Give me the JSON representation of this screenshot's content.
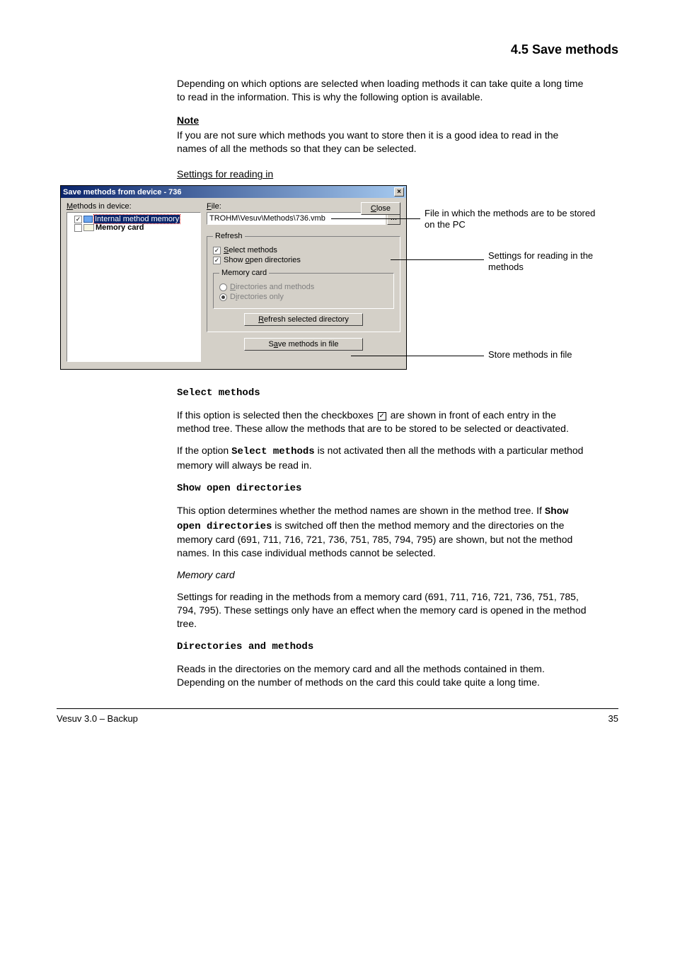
{
  "header": {
    "title": "4.5 Save methods"
  },
  "intro": {
    "p1": "Depending on which options are selected when loading methods it can take quite a long time to read in the information. This is why the following option is available.",
    "note_head": "Note",
    "note_text": "If you are not sure which methods you want to store then it is a good idea to read in the names of all the methods so that they can be selected.",
    "sub_head": "Settings for reading in"
  },
  "dialog": {
    "title": "Save methods from device - 736",
    "close_x": "×",
    "tree_label": "Methods in device:",
    "tree": {
      "internal": "Internal method memory",
      "card": "Memory card"
    },
    "file_label": "File:",
    "file_value": "TROHM\\Vesuv\\Methods\\736.vmb",
    "browse": "...",
    "close_btn": "Close",
    "refresh_group": "Refresh",
    "cb_select": "Select methods",
    "cb_showopen": "Show open directories",
    "mem_group": "Memory card",
    "rb_dirmeth": "Directories and methods",
    "rb_dironly": "Directories only",
    "btn_refresh": "Refresh selected directory",
    "btn_save": "Save methods in file"
  },
  "callouts": {
    "file": "File in which the methods are to be stored on the PC",
    "refresh": "Settings for reading in the methods",
    "save": "Store methods in file"
  },
  "body2": {
    "select_label": "Select methods",
    "select_p1_a": "If this option is selected then the checkboxes ",
    "select_p1_b": " are shown in front of each entry in the method tree. These allow the methods that are to be stored to be selected or deactivated.",
    "select_p2_a": "If the option ",
    "select_p2_b": " is not activated then all the methods with a particular method memory will always be read in.",
    "showopen_label": "Show open directories",
    "showopen_p_a": "This option determines whether the method names are shown in the method tree. If ",
    "showopen_p_b": " is switched off then the method memory and the directories on the memory card (691, 711, 716, 721, 736, 751, 785, 794, 795) are shown, but not the method names. In this case individual methods cannot be selected.",
    "memcard_head": "Memory card",
    "memcard_intro": "Settings for reading in the methods from a memory card (691, 711, 716, 721, 736, 751, 785, 794, 795). These settings only have an effect when the memory card is opened in the method tree.",
    "dirmeth_label": "Directories and methods",
    "dirmeth_text": "Reads in the directories on the memory card and all the methods contained in them. Depending on the number of methods on the card this could take quite a long time."
  },
  "footer": {
    "left": "Vesuv 3.0 – Backup",
    "right": "35"
  }
}
